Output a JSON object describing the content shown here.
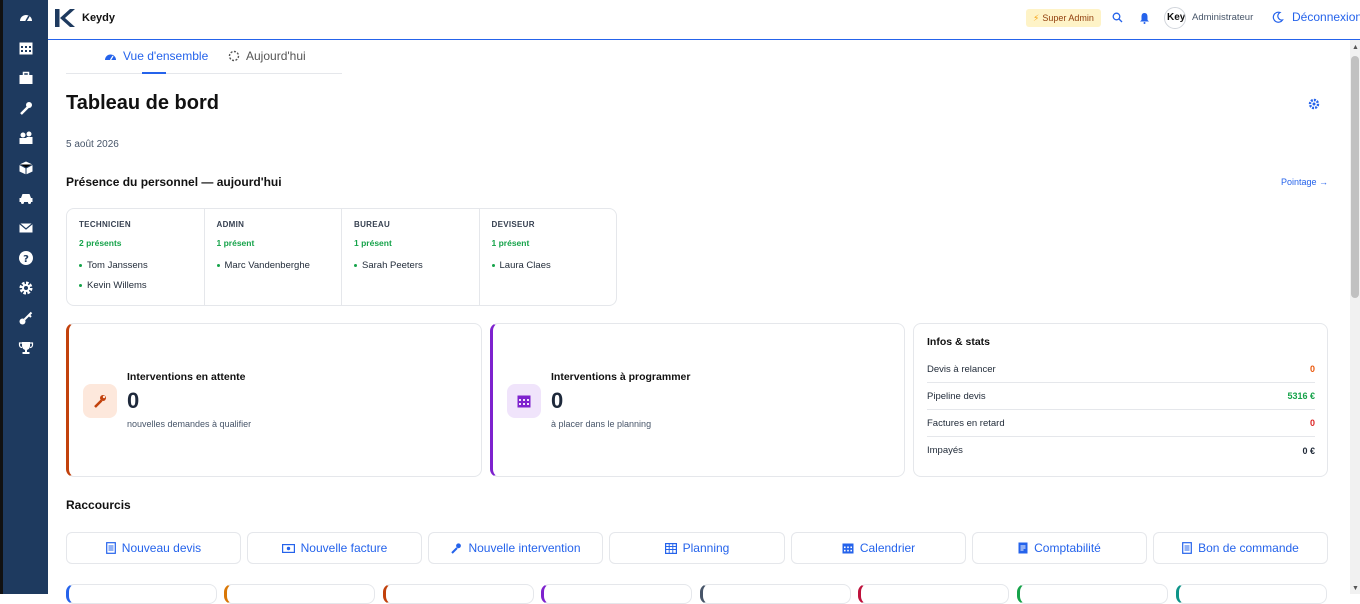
{
  "app": {
    "name": "Keydy",
    "badge": "Super Admin",
    "user": "Administrateur",
    "avatar_text": "Keyd",
    "logout": "Déconnexion"
  },
  "sidebar": {
    "icons": [
      "dashboard-icon",
      "calendar-icon",
      "briefcase-icon",
      "wrench-icon",
      "users-icon",
      "box-icon",
      "car-icon",
      "mail-icon",
      "help-icon",
      "settings-icon",
      "key-icon",
      "trophy-icon"
    ]
  },
  "tabs": [
    {
      "label": "Vue d'ensemble",
      "active": true
    },
    {
      "label": "Aujourd'hui",
      "active": false
    }
  ],
  "page": {
    "title": "Tableau de bord",
    "date": "5 août 2026"
  },
  "presence": {
    "title": "Présence du personnel — aujourd'hui",
    "link": "Pointage →",
    "columns": [
      {
        "role": "TECHNICIEN",
        "count": "2 présents",
        "names": [
          "Tom Janssens",
          "Kevin Willems"
        ]
      },
      {
        "role": "ADMIN",
        "count": "1 présent",
        "names": [
          "Marc Vandenberghe"
        ]
      },
      {
        "role": "BUREAU",
        "count": "1 présent",
        "names": [
          "Sarah Peeters"
        ]
      },
      {
        "role": "DEVISEUR",
        "count": "1 présent",
        "names": [
          "Laura Claes"
        ]
      }
    ]
  },
  "kpis": [
    {
      "title": "Interventions en attente",
      "value": "0",
      "sub": "nouvelles demandes à qualifier",
      "accent": "#c2410c"
    },
    {
      "title": "Interventions à programmer",
      "value": "0",
      "sub": "à placer dans le planning",
      "accent": "#7e22ce"
    }
  ],
  "stats": {
    "title": "Infos & stats",
    "rows": [
      {
        "label": "Devis à relancer",
        "value": "0",
        "color": "#ea580c"
      },
      {
        "label": "Pipeline devis",
        "value": "5316 €",
        "color": "#16a34a"
      },
      {
        "label": "Factures en retard",
        "value": "0",
        "color": "#dc2626"
      },
      {
        "label": "Impayés",
        "value": "0 €",
        "color": "#1f2937"
      }
    ]
  },
  "shortcuts": {
    "title": "Raccourcis",
    "items": [
      {
        "label": "Nouveau devis",
        "icon": "document-icon"
      },
      {
        "label": "Nouvelle facture",
        "icon": "invoice-icon"
      },
      {
        "label": "Nouvelle intervention",
        "icon": "wrench-icon"
      },
      {
        "label": "Planning",
        "icon": "planning-icon"
      },
      {
        "label": "Calendrier",
        "icon": "calendar-icon"
      },
      {
        "label": "Comptabilité",
        "icon": "accounting-icon"
      },
      {
        "label": "Bon de commande",
        "icon": "order-icon"
      }
    ]
  },
  "colors": {
    "primary": "#2563eb",
    "sidebar": "#1e3a5f",
    "success": "#16a34a"
  }
}
